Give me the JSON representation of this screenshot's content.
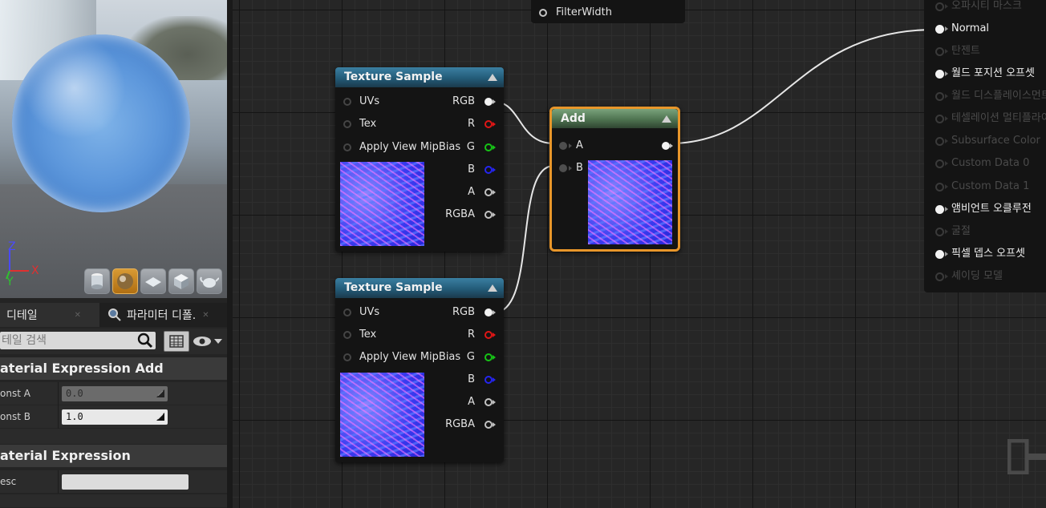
{
  "viewport": {
    "axis": {
      "z": "Z",
      "x": "X",
      "y": "Y"
    },
    "preview_buttons": [
      "cylinder-icon",
      "sphere-icon",
      "plane-icon",
      "cube-icon",
      "teapot-icon"
    ],
    "active_preview": "sphere-icon"
  },
  "details": {
    "tabs": [
      {
        "label": "디테일"
      },
      {
        "label": "파라미터 디폴."
      }
    ],
    "search_placeholder": "테일 검색",
    "sections": [
      {
        "title": "Material Expression Add",
        "visible_title": "aterial Expression Add"
      },
      {
        "title": "Material Expression",
        "visible_title": "aterial Expression"
      }
    ],
    "props": {
      "const_a": {
        "label": "onst A",
        "value": "0.0"
      },
      "const_b": {
        "label": "onst B",
        "value": "1.0"
      },
      "desc": {
        "label": "esc",
        "value": ""
      }
    }
  },
  "graph": {
    "top_node": {
      "pin": "FilterWidth"
    },
    "texture_sample_1": {
      "title": "Texture Sample",
      "inputs": [
        "UVs",
        "Tex",
        "Apply View MipBias"
      ],
      "outputs": [
        "RGB",
        "R",
        "G",
        "B",
        "A",
        "RGBA"
      ]
    },
    "texture_sample_2": {
      "title": "Texture Sample",
      "inputs": [
        "UVs",
        "Tex",
        "Apply View MipBias"
      ],
      "outputs": [
        "RGB",
        "R",
        "G",
        "B",
        "A",
        "RGBA"
      ]
    },
    "add_node": {
      "title": "Add",
      "inputs": [
        "A",
        "B"
      ],
      "selected_color": "#e8962a"
    },
    "result_node": {
      "pins": [
        {
          "label": "오파시티 마스크",
          "enabled": false
        },
        {
          "label": "Normal",
          "enabled": true
        },
        {
          "label": "탄젠트",
          "enabled": false
        },
        {
          "label": "월드 포지션 오프셋",
          "enabled": true
        },
        {
          "label": "월드 디스플레이스먼트",
          "enabled": false
        },
        {
          "label": "테셀레이션 멀티플라이어",
          "enabled": false
        },
        {
          "label": "Subsurface Color",
          "enabled": false
        },
        {
          "label": "Custom Data 0",
          "enabled": false
        },
        {
          "label": "Custom Data 1",
          "enabled": false
        },
        {
          "label": "앰비언트 오클루전",
          "enabled": true
        },
        {
          "label": "굴절",
          "enabled": false
        },
        {
          "label": "픽셀 뎁스 오프셋",
          "enabled": true
        },
        {
          "label": "셰이딩 모델",
          "enabled": false
        }
      ]
    }
  },
  "colors": {
    "pin_red": "#e01616",
    "pin_green": "#16c416",
    "pin_blue": "#2525f0",
    "wire": "#e6e6e6",
    "selection": "#e8962a"
  }
}
